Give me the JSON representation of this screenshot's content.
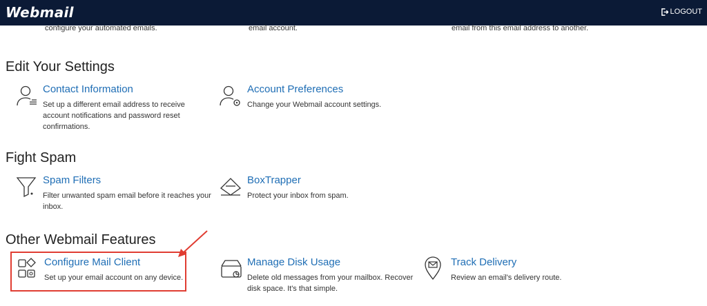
{
  "header": {
    "logo": "Webmail",
    "logout_label": "LOGOUT",
    "bg_color": "#0b1a36"
  },
  "partial_row": {
    "col1": "configure your automated emails.",
    "col2": "email account.",
    "col3": "email from this email address to another."
  },
  "sections": {
    "edit_settings": {
      "title": "Edit Your Settings",
      "contact": {
        "icon": "contact-icon",
        "title": "Contact Information",
        "desc": "Set up a different email address to receive account notifications and password reset confirmations."
      },
      "account": {
        "icon": "account-preferences-icon",
        "title": "Account Preferences",
        "desc": "Change your Webmail account settings."
      }
    },
    "fight_spam": {
      "title": "Fight Spam",
      "spam": {
        "icon": "filter-icon",
        "title": "Spam Filters",
        "desc": "Filter unwanted spam email before it reaches your inbox."
      },
      "boxtrapper": {
        "icon": "boxtrapper-icon",
        "title": "BoxTrapper",
        "desc": "Protect your inbox from spam."
      }
    },
    "other": {
      "title": "Other Webmail Features",
      "configure": {
        "icon": "apps-icon",
        "title": "Configure Mail Client",
        "desc": "Set up your email account on any device."
      },
      "disk": {
        "icon": "disk-icon",
        "title": "Manage Disk Usage",
        "desc": "Delete old messages from your mailbox. Recover disk space. It's that simple."
      },
      "track": {
        "icon": "location-pin-icon",
        "title": "Track Delivery",
        "desc": "Review an email's delivery route."
      }
    }
  },
  "colors": {
    "link": "#1f6eb5",
    "highlight": "#e03c31"
  }
}
